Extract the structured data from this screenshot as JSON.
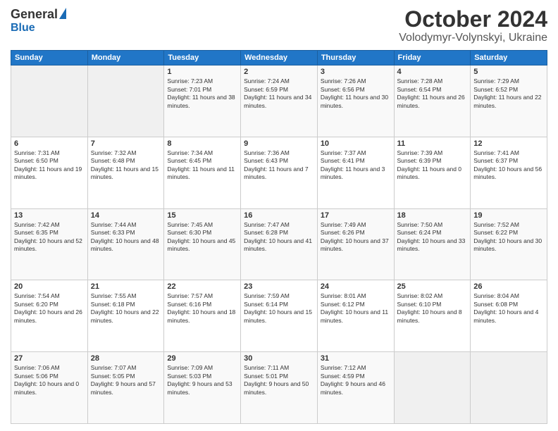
{
  "header": {
    "logo": {
      "general": "General",
      "blue": "Blue"
    },
    "title": "October 2024",
    "location": "Volodymyr-Volynskyi, Ukraine"
  },
  "weekdays": [
    "Sunday",
    "Monday",
    "Tuesday",
    "Wednesday",
    "Thursday",
    "Friday",
    "Saturday"
  ],
  "weeks": [
    [
      {
        "day": "",
        "sunrise": "",
        "sunset": "",
        "daylight": ""
      },
      {
        "day": "",
        "sunrise": "",
        "sunset": "",
        "daylight": ""
      },
      {
        "day": "1",
        "sunrise": "Sunrise: 7:23 AM",
        "sunset": "Sunset: 7:01 PM",
        "daylight": "Daylight: 11 hours and 38 minutes."
      },
      {
        "day": "2",
        "sunrise": "Sunrise: 7:24 AM",
        "sunset": "Sunset: 6:59 PM",
        "daylight": "Daylight: 11 hours and 34 minutes."
      },
      {
        "day": "3",
        "sunrise": "Sunrise: 7:26 AM",
        "sunset": "Sunset: 6:56 PM",
        "daylight": "Daylight: 11 hours and 30 minutes."
      },
      {
        "day": "4",
        "sunrise": "Sunrise: 7:28 AM",
        "sunset": "Sunset: 6:54 PM",
        "daylight": "Daylight: 11 hours and 26 minutes."
      },
      {
        "day": "5",
        "sunrise": "Sunrise: 7:29 AM",
        "sunset": "Sunset: 6:52 PM",
        "daylight": "Daylight: 11 hours and 22 minutes."
      }
    ],
    [
      {
        "day": "6",
        "sunrise": "Sunrise: 7:31 AM",
        "sunset": "Sunset: 6:50 PM",
        "daylight": "Daylight: 11 hours and 19 minutes."
      },
      {
        "day": "7",
        "sunrise": "Sunrise: 7:32 AM",
        "sunset": "Sunset: 6:48 PM",
        "daylight": "Daylight: 11 hours and 15 minutes."
      },
      {
        "day": "8",
        "sunrise": "Sunrise: 7:34 AM",
        "sunset": "Sunset: 6:45 PM",
        "daylight": "Daylight: 11 hours and 11 minutes."
      },
      {
        "day": "9",
        "sunrise": "Sunrise: 7:36 AM",
        "sunset": "Sunset: 6:43 PM",
        "daylight": "Daylight: 11 hours and 7 minutes."
      },
      {
        "day": "10",
        "sunrise": "Sunrise: 7:37 AM",
        "sunset": "Sunset: 6:41 PM",
        "daylight": "Daylight: 11 hours and 3 minutes."
      },
      {
        "day": "11",
        "sunrise": "Sunrise: 7:39 AM",
        "sunset": "Sunset: 6:39 PM",
        "daylight": "Daylight: 11 hours and 0 minutes."
      },
      {
        "day": "12",
        "sunrise": "Sunrise: 7:41 AM",
        "sunset": "Sunset: 6:37 PM",
        "daylight": "Daylight: 10 hours and 56 minutes."
      }
    ],
    [
      {
        "day": "13",
        "sunrise": "Sunrise: 7:42 AM",
        "sunset": "Sunset: 6:35 PM",
        "daylight": "Daylight: 10 hours and 52 minutes."
      },
      {
        "day": "14",
        "sunrise": "Sunrise: 7:44 AM",
        "sunset": "Sunset: 6:33 PM",
        "daylight": "Daylight: 10 hours and 48 minutes."
      },
      {
        "day": "15",
        "sunrise": "Sunrise: 7:45 AM",
        "sunset": "Sunset: 6:30 PM",
        "daylight": "Daylight: 10 hours and 45 minutes."
      },
      {
        "day": "16",
        "sunrise": "Sunrise: 7:47 AM",
        "sunset": "Sunset: 6:28 PM",
        "daylight": "Daylight: 10 hours and 41 minutes."
      },
      {
        "day": "17",
        "sunrise": "Sunrise: 7:49 AM",
        "sunset": "Sunset: 6:26 PM",
        "daylight": "Daylight: 10 hours and 37 minutes."
      },
      {
        "day": "18",
        "sunrise": "Sunrise: 7:50 AM",
        "sunset": "Sunset: 6:24 PM",
        "daylight": "Daylight: 10 hours and 33 minutes."
      },
      {
        "day": "19",
        "sunrise": "Sunrise: 7:52 AM",
        "sunset": "Sunset: 6:22 PM",
        "daylight": "Daylight: 10 hours and 30 minutes."
      }
    ],
    [
      {
        "day": "20",
        "sunrise": "Sunrise: 7:54 AM",
        "sunset": "Sunset: 6:20 PM",
        "daylight": "Daylight: 10 hours and 26 minutes."
      },
      {
        "day": "21",
        "sunrise": "Sunrise: 7:55 AM",
        "sunset": "Sunset: 6:18 PM",
        "daylight": "Daylight: 10 hours and 22 minutes."
      },
      {
        "day": "22",
        "sunrise": "Sunrise: 7:57 AM",
        "sunset": "Sunset: 6:16 PM",
        "daylight": "Daylight: 10 hours and 18 minutes."
      },
      {
        "day": "23",
        "sunrise": "Sunrise: 7:59 AM",
        "sunset": "Sunset: 6:14 PM",
        "daylight": "Daylight: 10 hours and 15 minutes."
      },
      {
        "day": "24",
        "sunrise": "Sunrise: 8:01 AM",
        "sunset": "Sunset: 6:12 PM",
        "daylight": "Daylight: 10 hours and 11 minutes."
      },
      {
        "day": "25",
        "sunrise": "Sunrise: 8:02 AM",
        "sunset": "Sunset: 6:10 PM",
        "daylight": "Daylight: 10 hours and 8 minutes."
      },
      {
        "day": "26",
        "sunrise": "Sunrise: 8:04 AM",
        "sunset": "Sunset: 6:08 PM",
        "daylight": "Daylight: 10 hours and 4 minutes."
      }
    ],
    [
      {
        "day": "27",
        "sunrise": "Sunrise: 7:06 AM",
        "sunset": "Sunset: 5:06 PM",
        "daylight": "Daylight: 10 hours and 0 minutes."
      },
      {
        "day": "28",
        "sunrise": "Sunrise: 7:07 AM",
        "sunset": "Sunset: 5:05 PM",
        "daylight": "Daylight: 9 hours and 57 minutes."
      },
      {
        "day": "29",
        "sunrise": "Sunrise: 7:09 AM",
        "sunset": "Sunset: 5:03 PM",
        "daylight": "Daylight: 9 hours and 53 minutes."
      },
      {
        "day": "30",
        "sunrise": "Sunrise: 7:11 AM",
        "sunset": "Sunset: 5:01 PM",
        "daylight": "Daylight: 9 hours and 50 minutes."
      },
      {
        "day": "31",
        "sunrise": "Sunrise: 7:12 AM",
        "sunset": "Sunset: 4:59 PM",
        "daylight": "Daylight: 9 hours and 46 minutes."
      },
      {
        "day": "",
        "sunrise": "",
        "sunset": "",
        "daylight": ""
      },
      {
        "day": "",
        "sunrise": "",
        "sunset": "",
        "daylight": ""
      }
    ]
  ]
}
